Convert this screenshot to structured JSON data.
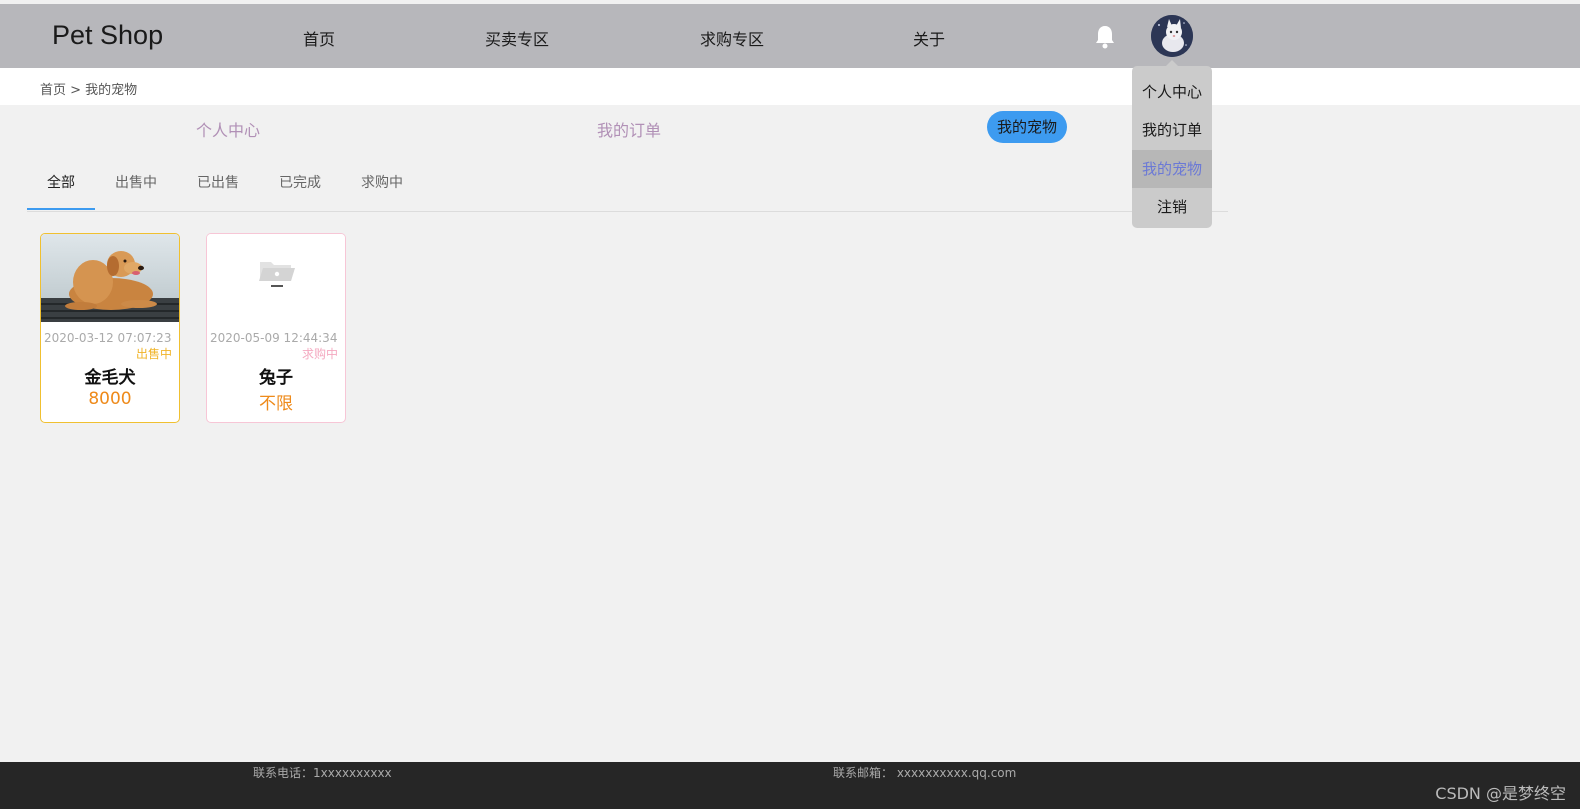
{
  "header": {
    "brand": "Pet Shop",
    "nav": [
      "首页",
      "买卖专区",
      "求购专区",
      "关于"
    ]
  },
  "breadcrumb": "首页 > 我的宠物",
  "subnav": {
    "items": [
      "个人中心",
      "我的订单",
      "我的宠物"
    ],
    "active_index": 2
  },
  "tabs": {
    "items": [
      "全部",
      "出售中",
      "已出售",
      "已完成",
      "求购中"
    ],
    "active_index": 0
  },
  "pets": [
    {
      "date": "2020-03-12 07:07:23",
      "status": "出售中",
      "name": "金毛犬",
      "price": "8000",
      "border_color": "#f0c030",
      "status_color": "#f0b428"
    },
    {
      "date": "2020-05-09 12:44:34",
      "status": "求购中",
      "name": "兔子",
      "price": "不限",
      "border_color": "#f7c6d6",
      "status_color": "#f4a9c0"
    }
  ],
  "user_menu": {
    "items": [
      "个人中心",
      "我的订单",
      "我的宠物",
      "注销"
    ],
    "active_index": 2
  },
  "footer": {
    "phone": "联系电话：1xxxxxxxxxx",
    "email": "联系邮箱： xxxxxxxxxx.qq.com",
    "watermark": "CSDN @是梦终空"
  },
  "colors": {
    "accent": "#3d9bf0",
    "header_bg": "#b7b7bb",
    "price": "#ee8a1a"
  },
  "icons": {
    "bell": "bell-icon",
    "avatar": "user-avatar",
    "placeholder": "folder-placeholder-icon"
  }
}
